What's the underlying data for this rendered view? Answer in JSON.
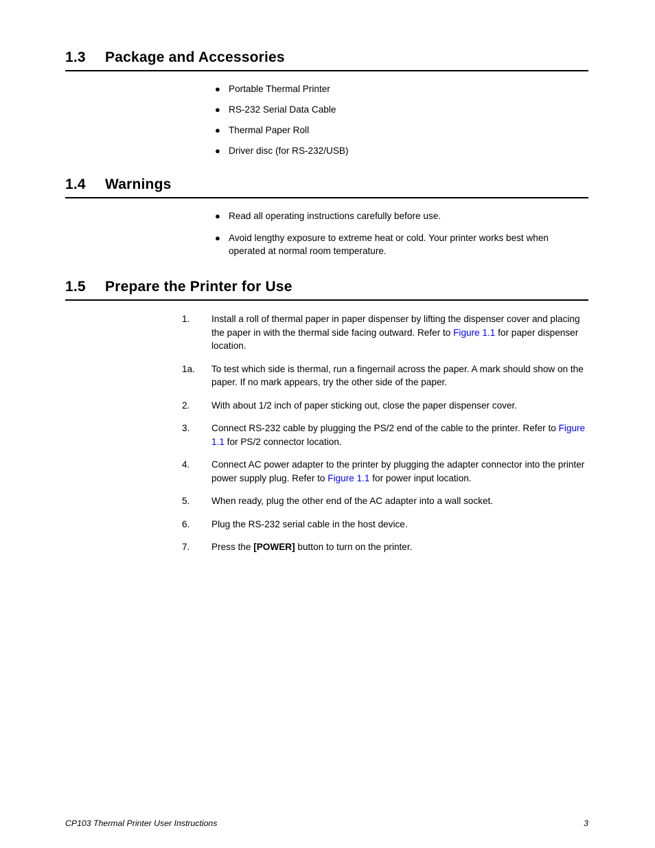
{
  "document": {
    "footer_text": "CP103 Thermal Printer User Instructions",
    "page_number": "3",
    "link_color": "#0000ff",
    "rule_color": "#000000"
  },
  "sections": {
    "package": {
      "number": "1.3",
      "title": "Package and Accessories",
      "bullet_symbol": "●",
      "items": [
        "Portable Thermal Printer",
        "RS-232 Serial Data Cable",
        "Thermal Paper Roll",
        "Driver disc (for RS-232/USB)"
      ]
    },
    "warnings": {
      "number": "1.4",
      "title": "Warnings",
      "bullet_symbol": "●",
      "items": [
        "Read all operating instructions carefully before use.",
        "Avoid lengthy exposure to extreme heat or cold. Your printer works best when operated at normal room temperature."
      ]
    },
    "prepare": {
      "number": "1.5",
      "title": "Prepare the Printer for Use",
      "steps": [
        {
          "label": "1.",
          "parts": [
            {
              "type": "text",
              "value": "Install a roll of thermal paper in paper dispenser by lifting the dispenser cover and placing the paper in with the thermal side facing outward. Refer to "
            },
            {
              "type": "link",
              "value": "Figure 1.1"
            },
            {
              "type": "text",
              "value": " for paper dispenser location."
            }
          ]
        },
        {
          "label": "1a.",
          "parts": [
            {
              "type": "text",
              "value": "To test which side is thermal, run a fingernail across the paper. A mark should show on the paper. If no mark appears, try the other side of the paper."
            }
          ]
        },
        {
          "label": "2.",
          "parts": [
            {
              "type": "text",
              "value": "With about 1/2 inch of paper sticking out, close the paper dispenser cover."
            }
          ]
        },
        {
          "label": "3.",
          "parts": [
            {
              "type": "text",
              "value": "Connect RS-232 cable by plugging the PS/2 end of the cable to the printer. Refer to "
            },
            {
              "type": "link",
              "value": "Figure 1.1"
            },
            {
              "type": "text",
              "value": " for PS/2 connector location."
            }
          ]
        },
        {
          "label": "4.",
          "parts": [
            {
              "type": "text",
              "value": "Connect AC power adapter to the printer by plugging the adapter connector into the printer power supply plug. Refer to "
            },
            {
              "type": "link",
              "value": "Figure 1.1"
            },
            {
              "type": "text",
              "value": " for power input location."
            }
          ]
        },
        {
          "label": "5.",
          "parts": [
            {
              "type": "text",
              "value": "When ready, plug the other end of the AC adapter into a wall socket."
            }
          ]
        },
        {
          "label": "6.",
          "parts": [
            {
              "type": "text",
              "value": "Plug the RS-232 serial cable in the host device."
            }
          ]
        },
        {
          "label": "7.",
          "parts": [
            {
              "type": "text",
              "value": "Press the "
            },
            {
              "type": "bold",
              "value": "[POWER]"
            },
            {
              "type": "text",
              "value": " button to turn on the printer."
            }
          ]
        }
      ]
    }
  }
}
